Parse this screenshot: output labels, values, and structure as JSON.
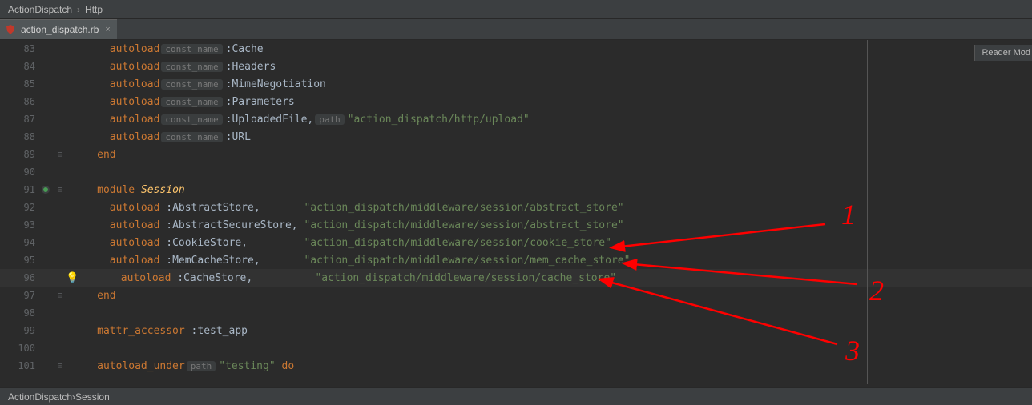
{
  "breadcrumb_top": {
    "part1": "ActionDispatch",
    "part2": "Http",
    "sep": "›"
  },
  "tab": {
    "filename": "action_dispatch.rb"
  },
  "reader_mode": "Reader Mod",
  "hints": {
    "const_name": "const_name",
    "path": "path"
  },
  "lines": [
    {
      "num": "83",
      "indent": "      ",
      "pre": "autoload",
      "hint": "const_name",
      "tail": ":Cache"
    },
    {
      "num": "84",
      "indent": "      ",
      "pre": "autoload",
      "hint": "const_name",
      "tail": ":Headers"
    },
    {
      "num": "85",
      "indent": "      ",
      "pre": "autoload",
      "hint": "const_name",
      "tail": ":MimeNegotiation"
    },
    {
      "num": "86",
      "indent": "      ",
      "pre": "autoload",
      "hint": "const_name",
      "tail": ":Parameters"
    },
    {
      "num": "87",
      "indent": "      ",
      "pre": "autoload",
      "hint": "const_name",
      "tail": ":UploadedFile,",
      "hint2": "path",
      "str": "\"action_dispatch/http/upload\""
    },
    {
      "num": "88",
      "indent": "      ",
      "pre": "autoload",
      "hint": "const_name",
      "tail": ":URL"
    },
    {
      "num": "89",
      "indent": "    ",
      "kw": "end",
      "fold": "⊟"
    },
    {
      "num": "90",
      "indent": ""
    },
    {
      "num": "91",
      "indent": "    ",
      "kw": "module ",
      "ital": "Session",
      "fold": "⊟",
      "modmark": true
    },
    {
      "num": "92",
      "indent": "      ",
      "pre": "autoload",
      "tail": " :AbstractStore,       ",
      "str": "\"action_dispatch/middleware/session/abstract_store\""
    },
    {
      "num": "93",
      "indent": "      ",
      "pre": "autoload",
      "tail": " :AbstractSecureStore, ",
      "str": "\"action_dispatch/middleware/session/abstract_store\""
    },
    {
      "num": "94",
      "indent": "      ",
      "pre": "autoload",
      "tail": " :CookieStore,         ",
      "str": "\"action_dispatch/middleware/session/cookie_store\""
    },
    {
      "num": "95",
      "indent": "      ",
      "pre": "autoload",
      "tail": " :MemCacheStore,       ",
      "str": "\"action_dispatch/middleware/session/mem_cache_store\""
    },
    {
      "num": "96",
      "indent": "      ",
      "pre": "autoload",
      "tail": " :CacheStore,          ",
      "str": "\"action_dispatch/middleware/session/cache_store\"",
      "active": true,
      "bulb": true
    },
    {
      "num": "97",
      "indent": "    ",
      "kw": "end",
      "fold": "⊟"
    },
    {
      "num": "98",
      "indent": ""
    },
    {
      "num": "99",
      "indent": "    ",
      "pre": "mattr_accessor",
      "tail": " :test_app"
    },
    {
      "num": "100",
      "indent": ""
    },
    {
      "num": "101",
      "indent": "    ",
      "pre": "autoload_under",
      "hint": "path",
      "str": "\"testing\"",
      "kw2": " do",
      "fold": "⊟"
    }
  ],
  "breadcrumb_bottom": {
    "part1": "ActionDispatch",
    "part2": "Session",
    "sep": "›"
  },
  "annotations": {
    "n1": "1",
    "n2": "2",
    "n3": "3"
  }
}
